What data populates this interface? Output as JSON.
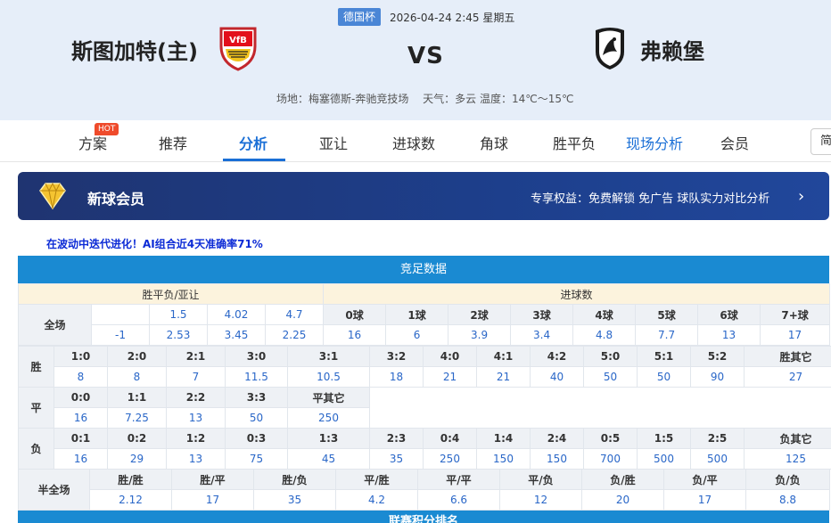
{
  "match": {
    "league": "德国杯",
    "datetime": "2026-04-24 2:45 星期五",
    "home": "斯图加特(主)",
    "away": "弗赖堡",
    "vs": "VS",
    "venue": "场地：梅塞德斯-奔驰竞技场",
    "weather": "天气：多云 温度：14℃～15℃"
  },
  "tabs": [
    {
      "label": "方案",
      "badge": "HOT"
    },
    {
      "label": "推荐"
    },
    {
      "label": "分析"
    },
    {
      "label": "亚让"
    },
    {
      "label": "进球数"
    },
    {
      "label": "角球"
    },
    {
      "label": "胜平负"
    },
    {
      "label": "现场分析"
    },
    {
      "label": "会员"
    }
  ],
  "active_tab": "分析",
  "language_switch": "简",
  "member_banner": {
    "title": "新球会员",
    "benefits": "专享权益：免费解锁 免广告 球队实力对比分析",
    "chevron": "›"
  },
  "promo_text": "在波动中迭代进化！AI组合近4天准确率71%",
  "odds_section": {
    "title": "竞足数据",
    "header_left": "胜平负/亚让",
    "header_right": "进球数",
    "full_label": "全场",
    "spf_row1": [
      "",
      "1.5",
      "4.02",
      "4.7"
    ],
    "spf_row2": [
      "-1",
      "2.53",
      "3.45",
      "2.25"
    ],
    "goal_labels": [
      "0球",
      "1球",
      "2球",
      "3球",
      "4球",
      "5球",
      "6球",
      "7+球"
    ],
    "goal_values": [
      "16",
      "6",
      "3.9",
      "3.4",
      "4.8",
      "7.7",
      "13",
      "17"
    ]
  },
  "score_section": {
    "win_label": "胜",
    "draw_label": "平",
    "lose_label": "负",
    "win_scores": [
      "1:0",
      "2:0",
      "2:1",
      "3:0",
      "3:1",
      "3:2",
      "4:0",
      "4:1",
      "4:2",
      "5:0",
      "5:1",
      "5:2",
      "胜其它"
    ],
    "win_odds": [
      "8",
      "8",
      "7",
      "11.5",
      "10.5",
      "18",
      "21",
      "21",
      "40",
      "50",
      "50",
      "90",
      "27"
    ],
    "draw_scores": [
      "0:0",
      "1:1",
      "2:2",
      "3:3",
      "平其它"
    ],
    "draw_odds": [
      "16",
      "7.25",
      "13",
      "50",
      "250"
    ],
    "lose_scores": [
      "0:1",
      "0:2",
      "1:2",
      "0:3",
      "1:3",
      "2:3",
      "0:4",
      "1:4",
      "2:4",
      "0:5",
      "1:5",
      "2:5",
      "负其它"
    ],
    "lose_odds": [
      "16",
      "29",
      "13",
      "75",
      "45",
      "35",
      "250",
      "150",
      "150",
      "700",
      "500",
      "500",
      "125"
    ]
  },
  "half_full": {
    "label": "半全场",
    "results": [
      "胜/胜",
      "胜/平",
      "胜/负",
      "平/胜",
      "平/平",
      "平/负",
      "负/胜",
      "负/平",
      "负/负"
    ],
    "odds": [
      "2.12",
      "17",
      "35",
      "4.2",
      "6.6",
      "12",
      "20",
      "17",
      "8.8"
    ]
  },
  "next_section_title": "联赛积分排名",
  "colors": {
    "accent_blue": "#1a6fd6",
    "section_blue": "#1a8ad2",
    "odds_blue": "#2a67c8",
    "header_beige": "#fcf3dd",
    "hot_red": "#ef4b2b",
    "banner_navy": "#1f3471"
  }
}
